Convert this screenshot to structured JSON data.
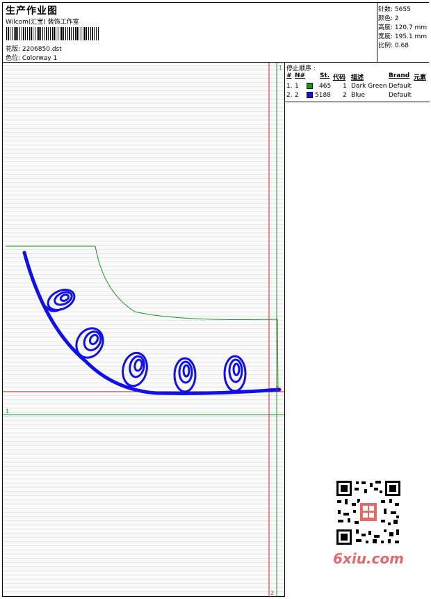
{
  "header": {
    "title": "生产作业图",
    "company": "Wilcom(汇宝) 装饰工作室",
    "design_file": "花版: 2206850.dst",
    "colorway": "色位: Colorway 1"
  },
  "stats": [
    {
      "label": "针数",
      "value": "5655"
    },
    {
      "label": "颜色",
      "value": "2"
    },
    {
      "label": "高度",
      "value": "120.7 mm"
    },
    {
      "label": "宽度",
      "value": "195.1 mm"
    },
    {
      "label": "比例",
      "value": "0.68"
    }
  ],
  "stop_sequence": {
    "title": "停止顺序 :",
    "columns": [
      "#",
      "N#",
      "St.",
      "代码",
      "描述",
      "Brand",
      "元素"
    ],
    "rows": [
      {
        "index": "1.",
        "n": "1",
        "stitches": "465",
        "code": "1",
        "description": "Dark Green",
        "brand": "Default",
        "color": "#159a15"
      },
      {
        "index": "2.",
        "n": "2",
        "stitches": "5188",
        "code": "2",
        "description": "Blue",
        "brand": "Default",
        "color": "#1010e8"
      }
    ]
  },
  "canvas": {
    "top_marker_red": "1",
    "top_marker_green": "1",
    "bottom_marker": "2",
    "left_marker": "1",
    "stop_marker": "2",
    "outline_color": "#159a15",
    "stitch_color": "#1010e8",
    "guide_color": "#e02020"
  },
  "watermark": "6xiu.com"
}
